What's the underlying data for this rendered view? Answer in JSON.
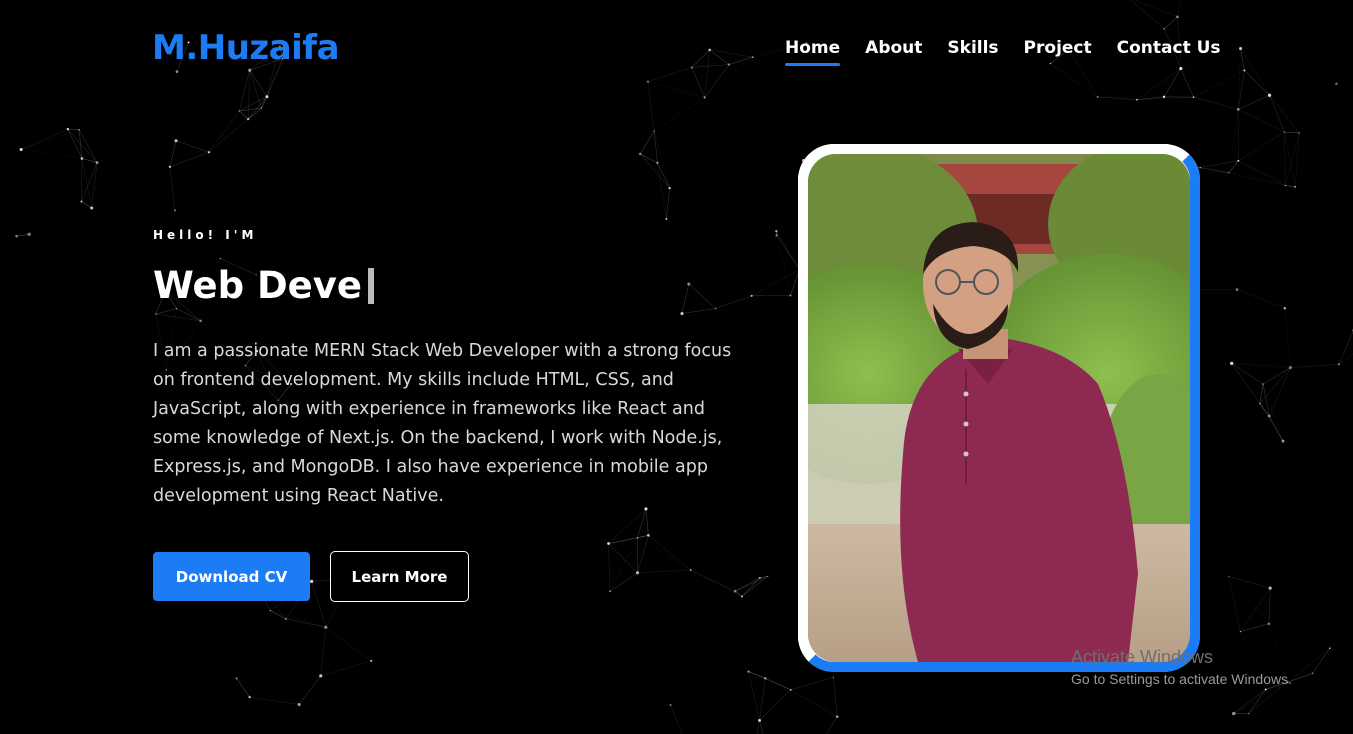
{
  "brand": {
    "logo": "M.Huzaifa",
    "accent": "#1b7cf5"
  },
  "nav": [
    {
      "label": "Home",
      "active": true
    },
    {
      "label": "About"
    },
    {
      "label": "Skills"
    },
    {
      "label": "Project"
    },
    {
      "label": "Contact Us"
    }
  ],
  "hero": {
    "greeting": "Hello! I'M",
    "typed_role": "Web Deve",
    "bio": "I am a passionate MERN Stack Web Developer with a strong focus on frontend development. My skills include HTML, CSS, and JavaScript, along with experience in frameworks like React and some knowledge of Next.js. On the backend, I work with Node.js, Express.js, and MongoDB. I also have experience in mobile app development using React Native.",
    "primary_button": "Download CV",
    "secondary_button": "Learn More"
  },
  "overlay": {
    "title": "Activate Windows",
    "subtitle": "Go to Settings to activate Windows."
  }
}
